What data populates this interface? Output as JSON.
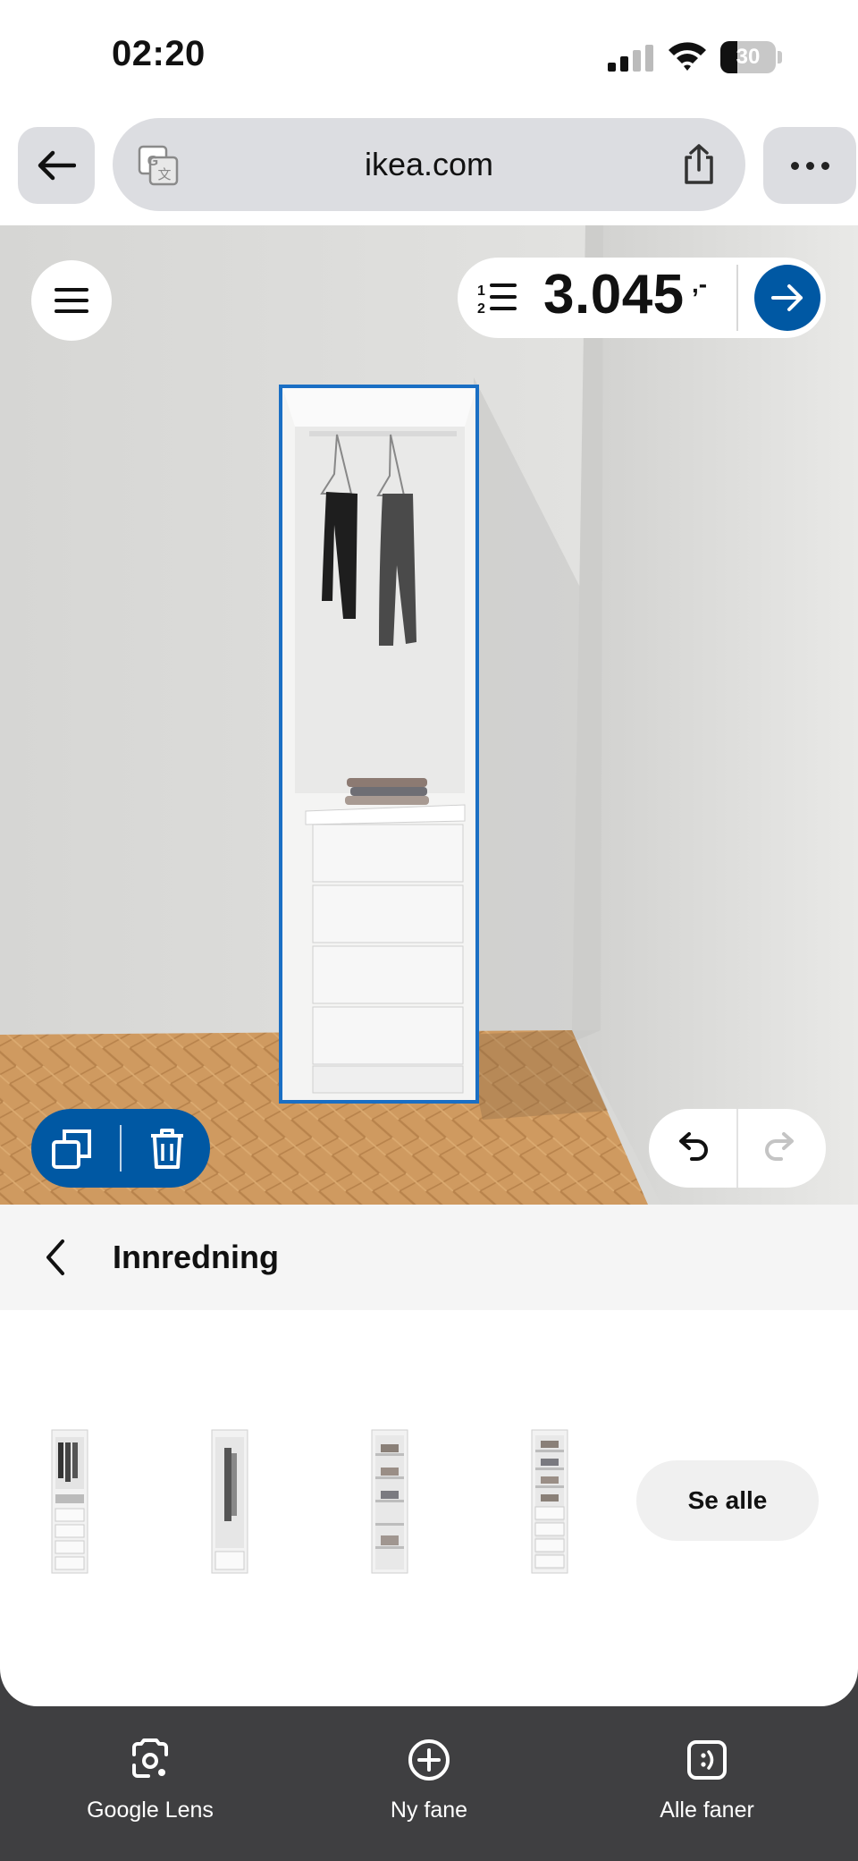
{
  "status_bar": {
    "time": "02:20",
    "battery_level": "30",
    "battery_fraction": 0.3
  },
  "toolbar": {
    "url": "ikea.com"
  },
  "planner": {
    "price": "3.045",
    "price_suffix": ",-",
    "colors": {
      "accent": "#0058a3",
      "selection": "#1a6fc4",
      "floor": "#c9935a"
    }
  },
  "section": {
    "title": "Innredning"
  },
  "products": {
    "items": [
      {
        "icon": "wardrobe-with-rail-and-drawers-icon"
      },
      {
        "icon": "wardrobe-with-long-rail-icon"
      },
      {
        "icon": "wardrobe-with-shelves-icon"
      },
      {
        "icon": "wardrobe-with-shelves-and-drawers-icon"
      }
    ],
    "see_all": "Se alle"
  },
  "bottom_bar": {
    "tabs": [
      {
        "label": "Google Lens",
        "icon": "google-lens-icon"
      },
      {
        "label": "Ny fane",
        "icon": "new-tab-icon"
      },
      {
        "label": "Alle faner",
        "icon": "all-tabs-icon"
      }
    ]
  }
}
